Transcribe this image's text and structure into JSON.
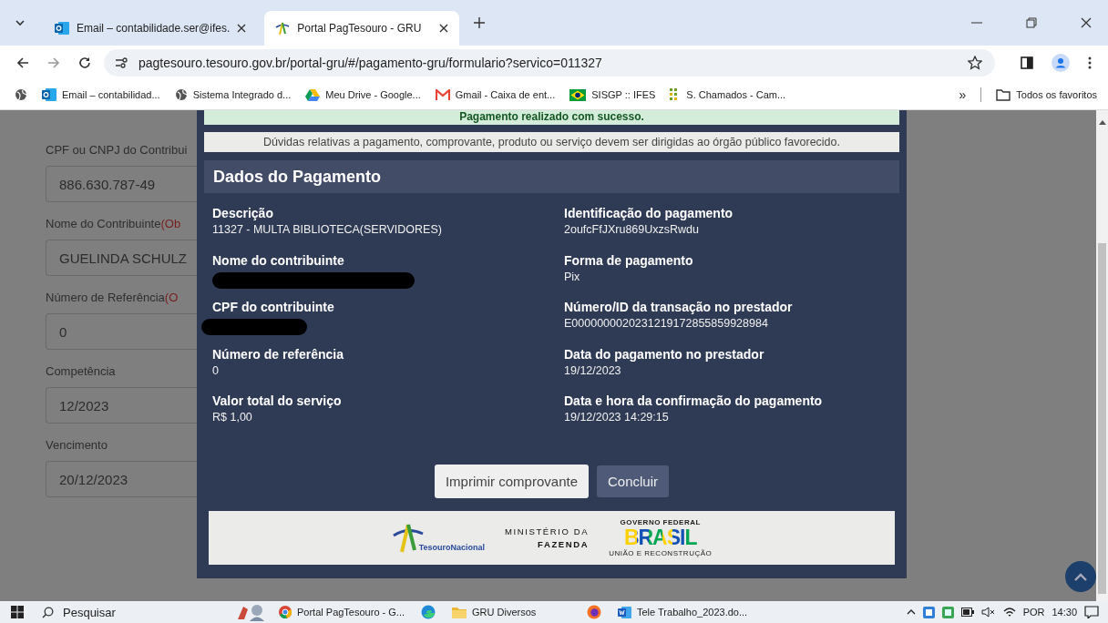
{
  "browser": {
    "tabs": [
      {
        "title": "Email – contabilidade.ser@ifes.",
        "kind": "outlook",
        "selected": false
      },
      {
        "title": "Portal PagTesouro - GRU",
        "kind": "tesouro",
        "selected": true
      }
    ],
    "url": "pagtesouro.tesouro.gov.br/portal-gru/#/pagamento-gru/formulario?servico=011327",
    "bookmarks": [
      {
        "label": "Email – contabilidad...",
        "kind": "outlook"
      },
      {
        "label": "Sistema Integrado d...",
        "kind": "globe"
      },
      {
        "label": "Meu Drive - Google...",
        "kind": "drive"
      },
      {
        "label": "Gmail - Caixa de ent...",
        "kind": "gmail"
      },
      {
        "label": "SISGP :: IFES",
        "kind": "flag"
      },
      {
        "label": "S. Chamados - Cam...",
        "kind": "grid"
      }
    ],
    "more": "»",
    "all_bookmarks": "Todos os favoritos"
  },
  "form": {
    "fields": [
      {
        "label": "CPF ou CNPJ do Contribui",
        "value": "886.630.787-49"
      },
      {
        "label": "Nome do Contribuinte",
        "note": "(Ob",
        "value": "GUELINDA SCHULZ"
      },
      {
        "label": "Número de Referência",
        "note": "(O",
        "value": "0"
      },
      {
        "label": "Competência",
        "value": "12/2023"
      },
      {
        "label": "Vencimento",
        "value": "20/12/2023"
      }
    ]
  },
  "modal": {
    "success": "Pagamento realizado com sucesso.",
    "notice": "Dúvidas relativas a pagamento, comprovante, produto ou serviço devem ser dirigidas ao órgão público favorecido.",
    "title": "Dados do Pagamento",
    "details": [
      {
        "label": "Descrição",
        "value": "11327 - MULTA BIBLIOTECA(SERVIDORES)",
        "redacted": false
      },
      {
        "label": "Identificação do pagamento",
        "value": "2oufcFfJXru869UxzsRwdu",
        "redacted": false
      },
      {
        "label": "Nome do contribuinte",
        "redacted": true
      },
      {
        "label": "Forma de pagamento",
        "value": "Pix",
        "redacted": false
      },
      {
        "label": "CPF do contribuinte",
        "redacted": true
      },
      {
        "label": "Número/ID da transação no prestador",
        "value": "E0000000020231219172855859928984",
        "redacted": false
      },
      {
        "label": "Número de referência",
        "value": "0",
        "redacted": false
      },
      {
        "label": "Data do pagamento no prestador",
        "value": "19/12/2023",
        "redacted": false
      },
      {
        "label": "Valor total do serviço",
        "value": "R$  1,00",
        "redacted": false
      },
      {
        "label": "Data e hora da confirmação do pagamento",
        "value": "19/12/2023 14:29:15",
        "redacted": false
      }
    ],
    "buttons": [
      {
        "label": "Imprimir comprovante",
        "kind": "light"
      },
      {
        "label": "Concluir",
        "kind": "dark"
      }
    ],
    "footer": {
      "tesouro": [
        "Tesouro",
        "Nacional"
      ],
      "ministry": [
        "MINISTÉRIO DA",
        "FAZENDA"
      ],
      "gov_top": "GOVERNO FEDERAL",
      "gov_word": "BRASIL",
      "gov_bottom": "UNIÃO E RECONSTRUÇÃO"
    }
  },
  "taskbar": {
    "search": "Pesquisar",
    "apps": [
      {
        "kind": "people"
      },
      {
        "kind": "chrome",
        "label": "Portal PagTesouro - G..."
      },
      {
        "kind": "edge"
      },
      {
        "kind": "folder",
        "label": "GRU Diversos"
      },
      {
        "kind": "firefox"
      },
      {
        "kind": "word",
        "label": "Tele Trabalho_2023.do..."
      }
    ],
    "language": "POR",
    "time": "14:30"
  }
}
